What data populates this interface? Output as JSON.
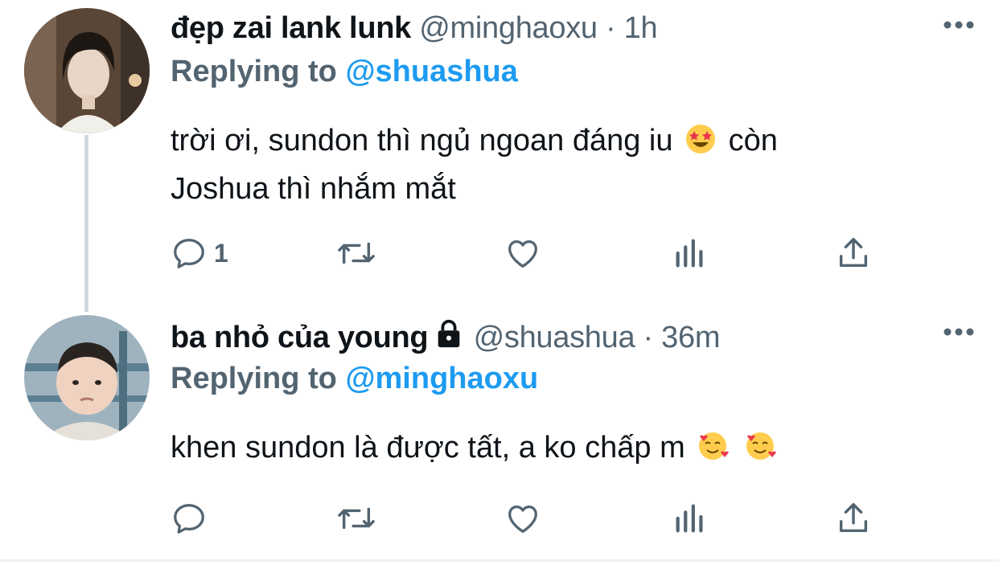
{
  "tweets": [
    {
      "name": "đẹp zai lank lunk",
      "handle": "@minghaoxu",
      "separator": "·",
      "time": "1h",
      "replying_label": "Replying to",
      "replying_to": "@shuashua",
      "text_line1": "trời ơi, sundon thì ngủ ngoan đáng iu",
      "text_line1_tail": "còn",
      "text_line2": "Joshua thì nhắm mắt",
      "reply_count": "1",
      "emoji": [
        "star-struck-emoji"
      ]
    },
    {
      "name": "ba nhỏ của young",
      "handle": "@shuashua",
      "separator": "·",
      "time": "36m",
      "replying_label": "Replying to",
      "replying_to": "@minghaoxu",
      "text": "khen sundon là được tất, a ko chấp m",
      "locked": true,
      "emoji": [
        "smiling-face-with-hearts-emoji",
        "smiling-face-with-hearts-emoji"
      ]
    }
  ],
  "colors": {
    "text": "#0f1419",
    "secondary": "#536471",
    "mention": "#1d9bf0",
    "thread_line": "#cfd9de"
  }
}
